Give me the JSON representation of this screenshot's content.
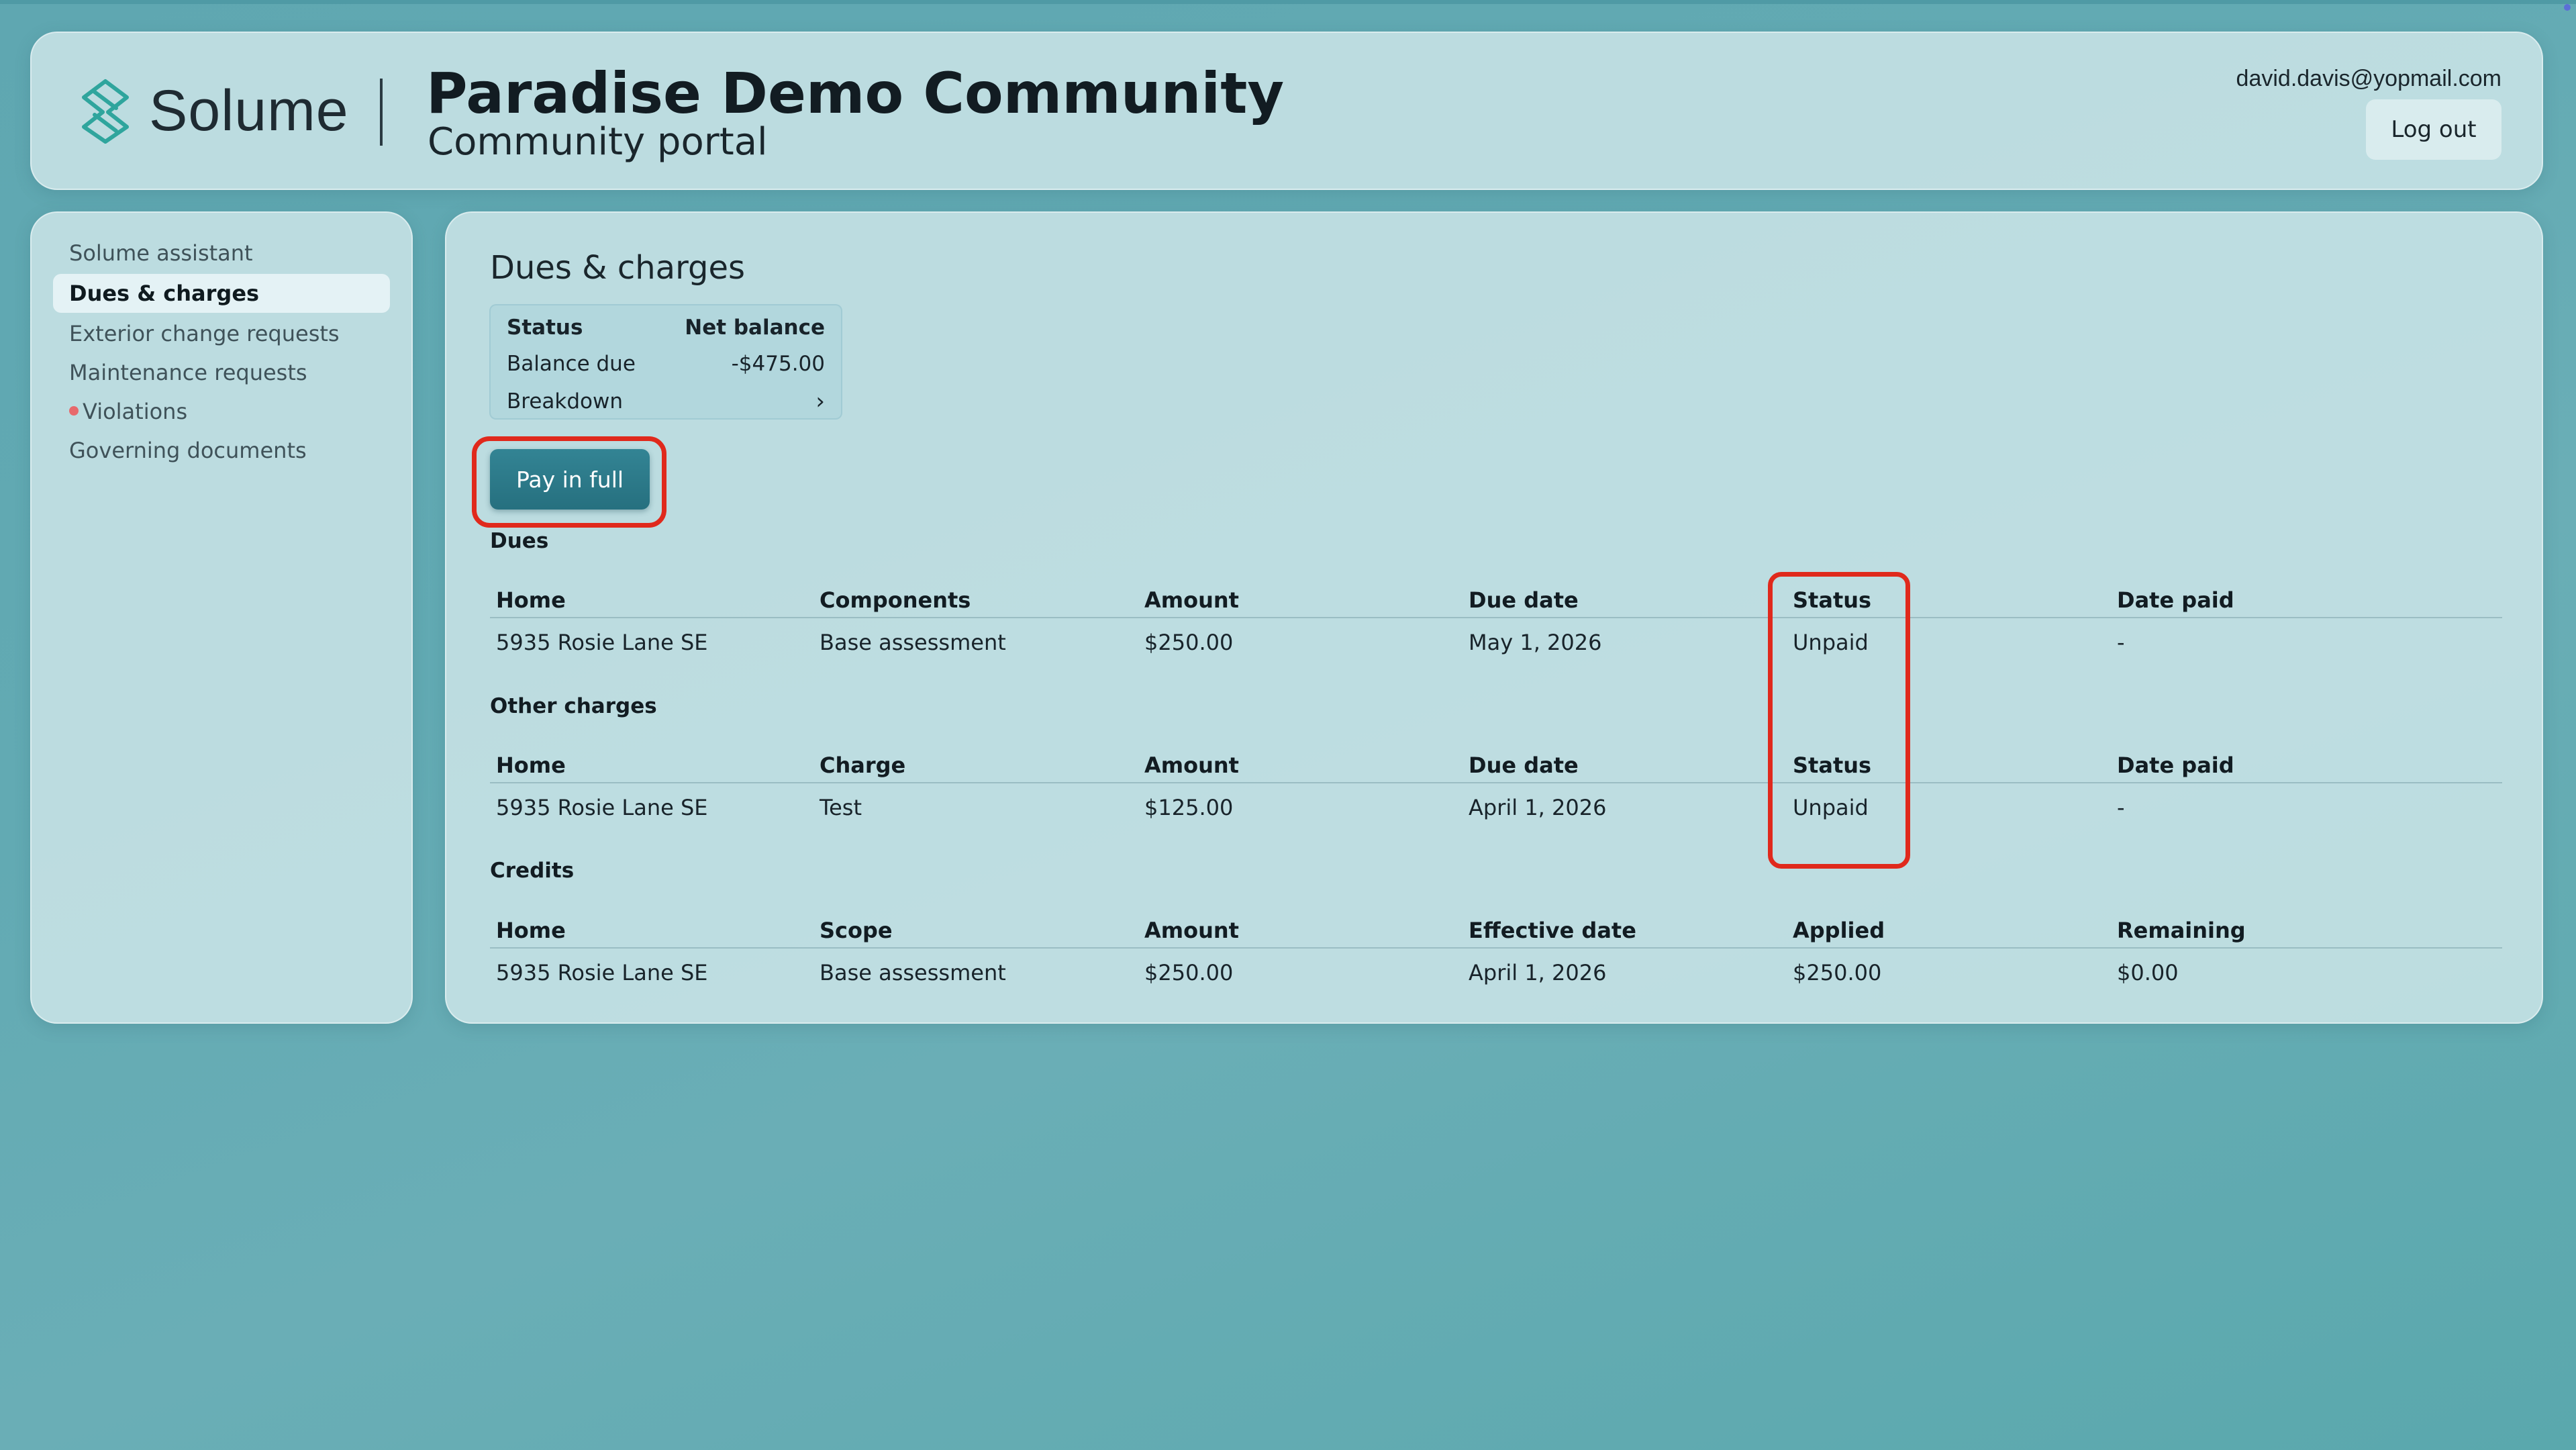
{
  "header": {
    "brand_name": "Solume",
    "community_name": "Paradise Demo Community",
    "portal_label": "Community portal",
    "user_email": "david.davis@yopmail.com",
    "logout_label": "Log out"
  },
  "sidebar": {
    "items": [
      {
        "label": "Solume assistant",
        "active": false
      },
      {
        "label": "Dues & charges",
        "active": true
      },
      {
        "label": "Exterior change requests",
        "active": false
      },
      {
        "label": "Maintenance requests",
        "active": false
      },
      {
        "label": "Violations",
        "active": false,
        "alert_dot": true
      },
      {
        "label": "Governing documents",
        "active": false
      }
    ]
  },
  "main": {
    "title": "Dues & charges",
    "balance": {
      "status_label": "Status",
      "net_balance_label": "Net balance",
      "balance_due_label": "Balance due",
      "balance_due_value": "-$475.00",
      "breakdown_label": "Breakdown"
    },
    "pay_button_label": "Pay in full",
    "dues": {
      "title": "Dues",
      "columns": [
        "Home",
        "Components",
        "Amount",
        "Due date",
        "Status",
        "Date paid"
      ],
      "rows": [
        [
          "5935 Rosie Lane SE",
          "Base assessment",
          "$250.00",
          "May 1, 2026",
          "Unpaid",
          "-"
        ]
      ]
    },
    "other_charges": {
      "title": "Other charges",
      "columns": [
        "Home",
        "Charge",
        "Amount",
        "Due date",
        "Status",
        "Date paid"
      ],
      "rows": [
        [
          "5935 Rosie Lane SE",
          "Test",
          "$125.00",
          "April 1, 2026",
          "Unpaid",
          "-"
        ]
      ]
    },
    "credits": {
      "title": "Credits",
      "columns": [
        "Home",
        "Scope",
        "Amount",
        "Effective date",
        "Applied",
        "Remaining"
      ],
      "rows": [
        [
          "5935 Rosie Lane SE",
          "Base assessment",
          "$250.00",
          "April 1, 2026",
          "$250.00",
          "$0.00"
        ]
      ]
    }
  },
  "colors": {
    "accent": "#2b7b8a",
    "highlight": "#e0291c",
    "alert_dot": "#e7696c",
    "background": "#62aab3"
  }
}
